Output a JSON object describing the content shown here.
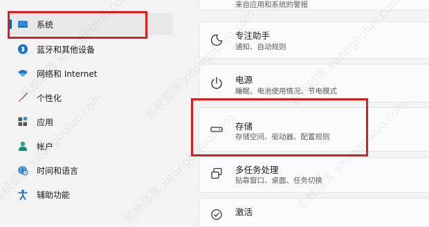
{
  "sidebar": {
    "items": [
      {
        "label": "系统",
        "icon": "display-icon",
        "selected": true
      },
      {
        "label": "蓝牙和其他设备",
        "icon": "bluetooth-icon"
      },
      {
        "label": "网络和 Internet",
        "icon": "wifi-icon"
      },
      {
        "label": "个性化",
        "icon": "brush-icon"
      },
      {
        "label": "应用",
        "icon": "apps-icon"
      },
      {
        "label": "帐户",
        "icon": "person-icon"
      },
      {
        "label": "时间和语言",
        "icon": "globe-clock-icon"
      },
      {
        "label": "辅助功能",
        "icon": "accessibility-icon"
      }
    ]
  },
  "main": {
    "cards": [
      {
        "title": "",
        "subtitle": "来自应用和系统的警报",
        "icon": ""
      },
      {
        "title": "专注助手",
        "subtitle": "通知、自动规则",
        "icon": "moon-icon"
      },
      {
        "title": "电源",
        "subtitle": "睡眠、电池使用情况、节电模式",
        "icon": "power-icon"
      },
      {
        "title": "存储",
        "subtitle": "存储空间、驱动器、配置规则",
        "icon": "drive-icon"
      },
      {
        "title": "多任务处理",
        "subtitle": "贴靠窗口、桌面、任务切换",
        "icon": "multitask-icon"
      },
      {
        "title": "激活",
        "subtitle": "",
        "icon": "activation-icon"
      }
    ]
  },
  "watermark": "系统部落 xitongbuluo.com",
  "colors": {
    "accent": "#0067c0",
    "highlight": "#d5201f",
    "background": "#f3f3f3"
  }
}
